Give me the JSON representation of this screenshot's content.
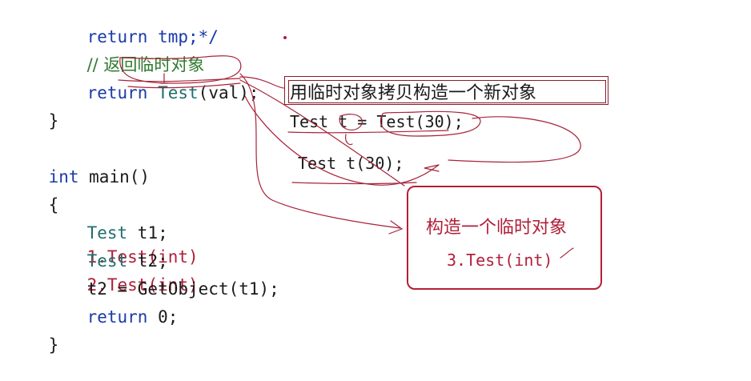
{
  "code": {
    "line1": "return tmp;*/",
    "line2": "// 返回临时对象",
    "line3_kw": "return",
    "line3_type": "Test",
    "line3_rest": "(val);",
    "line4": "}",
    "line5_kw": "int",
    "line5_rest": " main()",
    "line6": "{",
    "line7_type": "Test",
    "line7_rest": " t1;",
    "line7_note_num": "1.",
    "line7_note_type": "Test",
    "line7_note_rest": "(int)",
    "line8_type": "Test",
    "line8_rest": " t2;",
    "line8_note_num": "2.",
    "line8_note_type": "Test",
    "line8_note_rest": "(int)",
    "line9": "t2 = GetObject(t1);",
    "line10_kw": "return",
    "line10_rest": " 0;",
    "line11": "}"
  },
  "annotations": {
    "copy_note": "用临时对象拷贝构造一个新对象",
    "eq_line": "Test t = Test(30);",
    "direct_line": "Test t(30);",
    "panel_title": "构造一个临时对象",
    "panel_sub": "3.Test(int)"
  },
  "colors": {
    "keyword": "#1a3aa8",
    "type": "#1f6f6f",
    "comment": "#2f7a2f",
    "annotation_red": "#b0203a"
  }
}
